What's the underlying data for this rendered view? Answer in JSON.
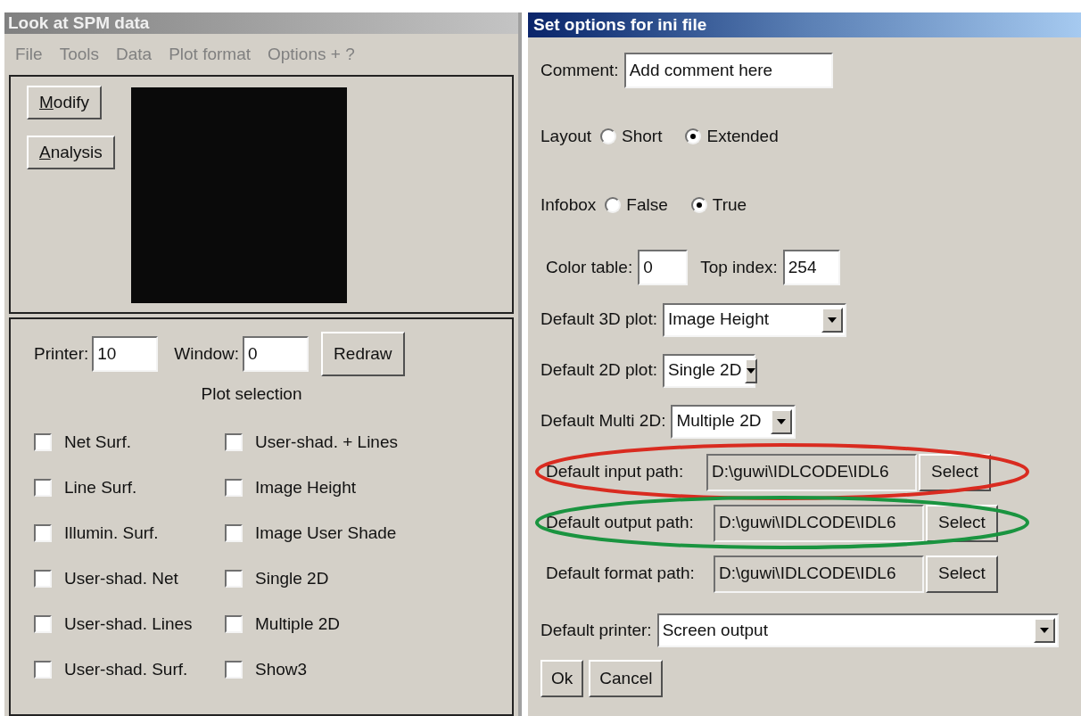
{
  "left_window": {
    "title": "Look at SPM data",
    "menu": [
      "File",
      "Tools",
      "Data",
      "Plot format",
      "Options + ?"
    ],
    "buttons": [
      "Modify",
      "Analysis"
    ],
    "printer": {
      "label": "Printer:",
      "value": "10"
    },
    "window_field": {
      "label": "Window:",
      "value": "0"
    },
    "redraw": "Redraw",
    "plot_selection": {
      "title": "Plot selection",
      "columns": [
        [
          {
            "label": "Net Surf.",
            "checked": false
          },
          {
            "label": "Line Surf.",
            "checked": false
          },
          {
            "label": "Illumin. Surf.",
            "checked": false
          },
          {
            "label": "User-shad. Net",
            "checked": false
          },
          {
            "label": "User-shad. Lines",
            "checked": false
          },
          {
            "label": "User-shad. Surf.",
            "checked": false
          }
        ],
        [
          {
            "label": "User-shad. + Lines",
            "checked": false
          },
          {
            "label": "Image Height",
            "checked": false
          },
          {
            "label": "Image User Shade",
            "checked": false
          },
          {
            "label": "Single 2D",
            "checked": false
          },
          {
            "label": "Multiple 2D",
            "checked": false
          },
          {
            "label": "Show3",
            "checked": false
          }
        ]
      ]
    }
  },
  "right_window": {
    "title": "Set options for ini file",
    "comment": {
      "label": "Comment:",
      "value": "Add comment here"
    },
    "radio_groups": [
      {
        "label": "Layout",
        "options": [
          {
            "label": "Short",
            "selected": false
          },
          {
            "label": "Extended",
            "selected": true
          }
        ]
      },
      {
        "label": "Infobox",
        "options": [
          {
            "label": "False",
            "selected": false
          },
          {
            "label": "True",
            "selected": true
          }
        ]
      }
    ],
    "color_table": {
      "label": "Color table:",
      "value": "0"
    },
    "top_index": {
      "label": "Top index:",
      "value": "254"
    },
    "dropdowns": [
      {
        "label": "Default 3D plot:",
        "value": "Image Height"
      },
      {
        "label": "Default 2D plot:",
        "value": "Single 2D"
      },
      {
        "label": "Default Multi 2D:",
        "value": "Multiple 2D"
      }
    ],
    "paths": [
      {
        "label": "Default input path:",
        "value": "D:\\guwi\\IDLCODE\\IDL6",
        "button": "Select"
      },
      {
        "label": "Default output path:",
        "value": "D:\\guwi\\IDLCODE\\IDL6",
        "button": "Select"
      },
      {
        "label": "Default format path:",
        "value": "D:\\guwi\\IDLCODE\\IDL6",
        "button": "Select"
      }
    ],
    "printer": {
      "label": "Default printer:",
      "value": "Screen output"
    },
    "buttons": [
      "Ok",
      "Cancel"
    ]
  },
  "annotations": [
    {
      "color": "#d92b20"
    },
    {
      "color": "#1a9440"
    }
  ]
}
